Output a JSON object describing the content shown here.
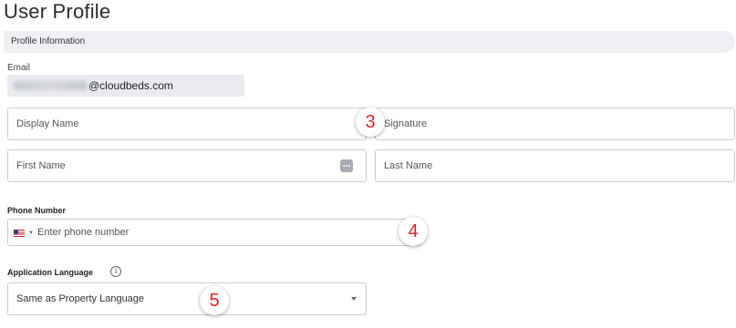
{
  "page": {
    "title": "User Profile"
  },
  "section": {
    "label": "Profile Information"
  },
  "email": {
    "label": "Email",
    "domain": "@cloudbeds.com"
  },
  "fields": {
    "display_name": {
      "placeholder": "Display Name"
    },
    "signature": {
      "placeholder": "Signature"
    },
    "first_name": {
      "placeholder": "First Name"
    },
    "last_name": {
      "placeholder": "Last Name"
    }
  },
  "phone": {
    "label": "Phone Number",
    "placeholder": "Enter phone number",
    "country_flag": "US"
  },
  "language": {
    "label": "Application Language",
    "info_icon": "info-circle-icon",
    "value": "Same as Property Language"
  },
  "badges": {
    "b3": "3",
    "b4": "4",
    "b5": "5"
  },
  "colors": {
    "badge_text": "#e0202b",
    "section_bg": "#eef0f3",
    "field_border": "#c9ccd1"
  }
}
